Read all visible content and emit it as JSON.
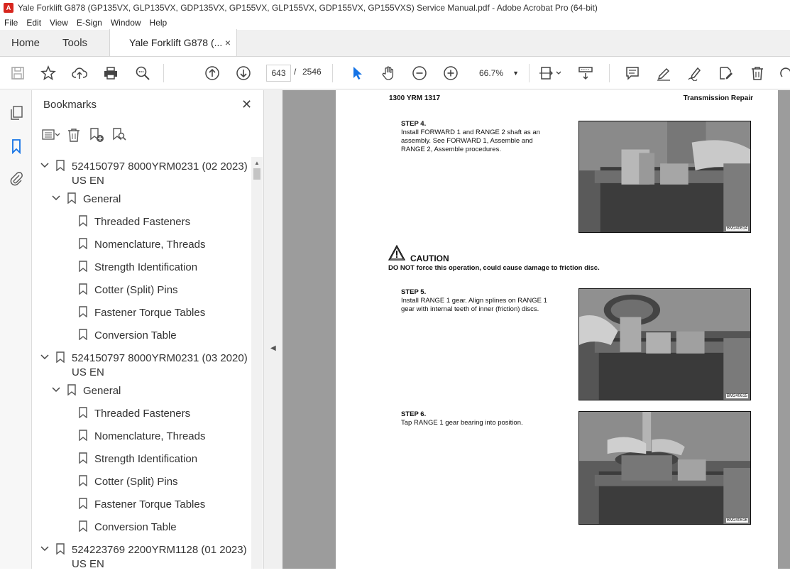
{
  "window": {
    "title": "Yale Forklift G878 (GP135VX, GLP135VX, GDP135VX, GP155VX, GLP155VX, GDP155VX, GP155VXS) Service Manual.pdf - Adobe Acrobat Pro (64-bit)"
  },
  "menu": [
    "File",
    "Edit",
    "View",
    "E-Sign",
    "Window",
    "Help"
  ],
  "tabs": {
    "home": "Home",
    "tools": "Tools",
    "document": "Yale Forklift G878 (...",
    "close": "×"
  },
  "toolbar": {
    "current_page": "643",
    "separator": "/",
    "total_pages": "2546",
    "zoom": "66.7%"
  },
  "bookmarks": {
    "title": "Bookmarks",
    "close": "✕",
    "items": [
      {
        "label": "524150797 8000YRM0231 (02 2023)",
        "label2": "US EN",
        "level": 0
      },
      {
        "label": "General",
        "level": 1
      },
      {
        "label": "Threaded Fasteners",
        "level": 2
      },
      {
        "label": "Nomenclature, Threads",
        "level": 2
      },
      {
        "label": "Strength Identification",
        "level": 2
      },
      {
        "label": "Cotter (Split) Pins",
        "level": 2
      },
      {
        "label": "Fastener Torque Tables",
        "level": 2
      },
      {
        "label": "Conversion Table",
        "level": 2
      },
      {
        "label": "524150797 8000YRM0231 (03 2020)",
        "label2": "US EN",
        "level": 0
      },
      {
        "label": "General",
        "level": 1
      },
      {
        "label": "Threaded Fasteners",
        "level": 2
      },
      {
        "label": "Nomenclature, Threads",
        "level": 2
      },
      {
        "label": "Strength Identification",
        "level": 2
      },
      {
        "label": "Cotter (Split) Pins",
        "level": 2
      },
      {
        "label": "Fastener Torque Tables",
        "level": 2
      },
      {
        "label": "Conversion Table",
        "level": 2
      },
      {
        "label": "524223769 2200YRM1128 (01 2023)",
        "label2": "US EN",
        "level": 0
      }
    ]
  },
  "document": {
    "header_left": "1300 YRM 1317",
    "header_right": "Transmission Repair",
    "step4": {
      "title": "STEP 4.",
      "line1": "Install FORWARD 1 and RANGE 2 shaft as an",
      "line2": "assembly. See FORWARD 1, Assemble and",
      "line3": "RANGE 2, Assemble procedures.",
      "photo_code": "BM240614"
    },
    "caution": {
      "title": "CAUTION",
      "text": "DO NOT force this operation, could cause damage to friction disc."
    },
    "step5": {
      "title": "STEP 5.",
      "line1": "Install RANGE 1 gear. Align splines on RANGE 1",
      "line2": "gear with internal teeth of inner (friction) discs.",
      "photo_code": "BM240615"
    },
    "step6": {
      "title": "STEP 6.",
      "line1": "Tap RANGE 1 gear bearing into position.",
      "photo_code": "BM240616"
    }
  },
  "colors": {
    "accent_blue": "#1473e6",
    "viewport_gray": "#9c9c9c",
    "adobe_red": "#d7261e"
  }
}
